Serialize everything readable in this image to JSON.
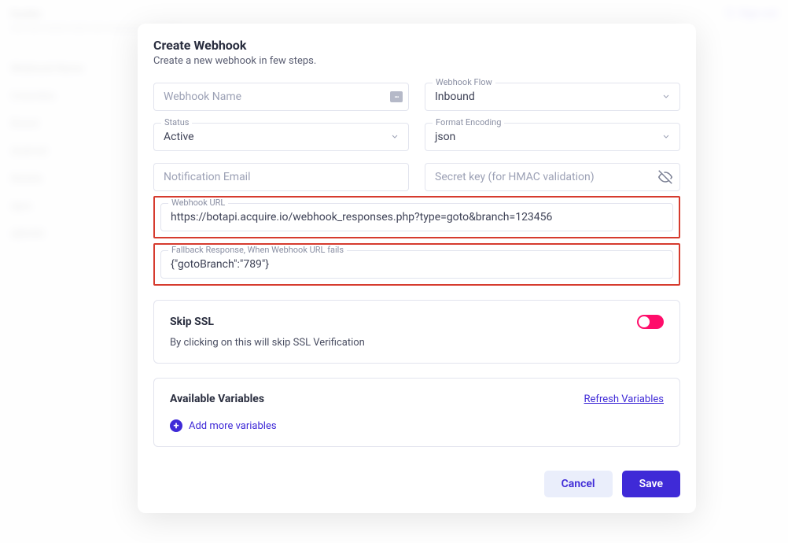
{
  "background": {
    "title": "hooks",
    "subtitle": "xxx xxx xxxxx xxxx xxx xxxxxxxx xxx xxxx",
    "signout": "Sign out",
    "sidebar": [
      "Webhook Name",
      "Columbia",
      "Brand",
      "Android",
      "Mobile",
      "dpm",
      "djtbfdit"
    ]
  },
  "modal": {
    "title": "Create Webhook",
    "subtitle": "Create a new webhook in few steps.",
    "fields": {
      "webhookName": {
        "placeholder": "Webhook Name",
        "value": ""
      },
      "webhookFlow": {
        "label": "Webhook Flow",
        "value": "Inbound"
      },
      "status": {
        "label": "Status",
        "value": "Active"
      },
      "formatEncoding": {
        "label": "Format Encoding",
        "value": "json"
      },
      "notificationEmail": {
        "placeholder": "Notification Email",
        "value": ""
      },
      "secretKey": {
        "placeholder": "Secret key (for HMAC validation)",
        "value": ""
      },
      "webhookUrl": {
        "label": "Webhook URL",
        "value": "https://botapi.acquire.io/webhook_responses.php?type=goto&branch=123456"
      },
      "fallback": {
        "label": "Fallback Response, When Webhook URL fails",
        "value": "{\"gotoBranch\":\"789\"}"
      }
    },
    "skipSsl": {
      "title": "Skip SSL",
      "desc": "By clicking on this will skip SSL Verification",
      "on": true
    },
    "variables": {
      "title": "Available Variables",
      "refresh": "Refresh Variables",
      "add": "Add more variables"
    },
    "footer": {
      "cancel": "Cancel",
      "save": "Save"
    }
  }
}
